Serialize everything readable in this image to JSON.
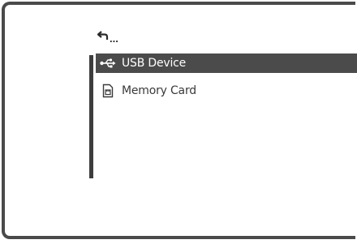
{
  "navigation": {
    "back_label": "..."
  },
  "menu": {
    "items": [
      {
        "label": "USB Device",
        "icon": "usb-icon",
        "selected": true
      },
      {
        "label": "Memory Card",
        "icon": "memory-card-icon",
        "selected": false
      }
    ]
  },
  "colors": {
    "frame": "#4a4a4a",
    "selected_bg": "#4b4b4b",
    "selected_text": "#ffffff",
    "text": "#3a3a3a"
  }
}
